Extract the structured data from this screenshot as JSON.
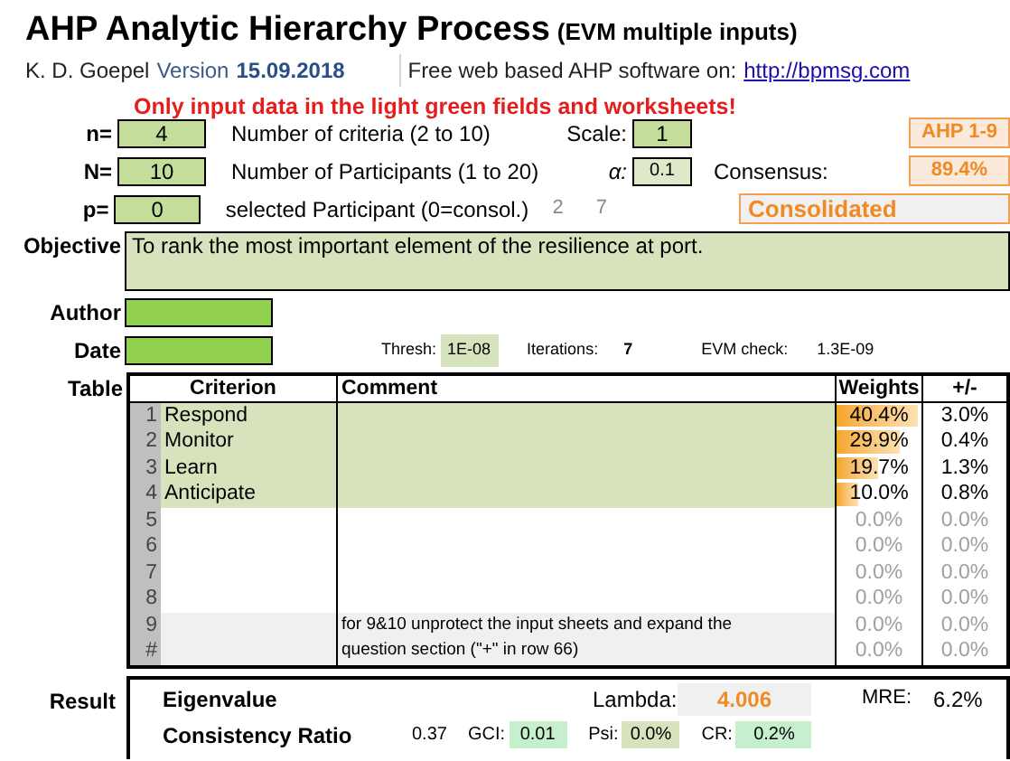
{
  "title": "AHP Analytic Hierarchy Process",
  "title_suffix": "(EVM multiple inputs)",
  "author_line": {
    "author": "K. D. Goepel",
    "version_label": "Version",
    "version": "15.09.2018",
    "promo": "Free web based AHP software on:",
    "link": "http://bpmsg.com"
  },
  "warning": "Only input data in the light green fields and worksheets!",
  "params": [
    {
      "label": "n=",
      "value": "4",
      "description": "Number of criteria (2 to 10)",
      "extra_label": "Scale:",
      "extra_value": "1",
      "note_value": "AHP 1-9"
    },
    {
      "label": "N=",
      "value": "10",
      "description": "Number of Participants (1 to 20)",
      "extra_label": "α:",
      "extra_value": "0.1",
      "note_label": "Consensus:",
      "note_value": "89.4%"
    },
    {
      "label": "p=",
      "value": "0",
      "description": "selected Participant (0=consol.)",
      "extra_label": "2",
      "extra_value": "7",
      "note_value": "Consolidated"
    }
  ],
  "objective": {
    "label": "Objective",
    "value": "To rank the most important element of the resilience at port."
  },
  "author": {
    "label": "Author"
  },
  "date": {
    "label": "Date"
  },
  "stats": {
    "thresh_label": "Thresh:",
    "thresh": "1E-08",
    "iterations_label": "Iterations:",
    "iterations": "7",
    "evm_label": "EVM check:",
    "evm": "1.3E-09"
  },
  "table": {
    "label": "Table",
    "columns": [
      "Criterion",
      "Comment",
      "Weights",
      "+/-"
    ],
    "rows": [
      {
        "number": "1",
        "criterion": "Respond",
        "comment": "",
        "weight": "40.4%",
        "level": 0.95,
        "spread": "3.0%",
        "filled": true,
        "active": true
      },
      {
        "number": "2",
        "criterion": "Monitor",
        "comment": "",
        "weight": "29.9%",
        "level": 0.74,
        "spread": "0.4%",
        "filled": true,
        "active": true
      },
      {
        "number": "3",
        "criterion": "Learn",
        "comment": "",
        "weight": "19.7%",
        "level": 0.49,
        "spread": "1.3%",
        "filled": true,
        "active": true
      },
      {
        "number": "4",
        "criterion": "Anticipate",
        "comment": "",
        "weight": "10.0%",
        "level": 0.25,
        "spread": "0.8%",
        "filled": true,
        "active": true
      },
      {
        "number": "5",
        "criterion": "",
        "comment": "",
        "weight": "0.0%",
        "spread": "0.0%",
        "filled": false,
        "active": false
      },
      {
        "number": "6",
        "criterion": "",
        "comment": "",
        "weight": "0.0%",
        "spread": "0.0%",
        "filled": false,
        "active": false
      },
      {
        "number": "7",
        "criterion": "",
        "comment": "",
        "weight": "0.0%",
        "spread": "0.0%",
        "filled": false,
        "active": false
      },
      {
        "number": "8",
        "criterion": "",
        "comment": "",
        "weight": "0.0%",
        "spread": "0.0%",
        "filled": false,
        "active": false
      },
      {
        "number": "9",
        "criterion": "",
        "comment": "for 9&10 unprotect the input sheets and expand the",
        "weight": "0.0%",
        "spread": "0.0%",
        "filled": false,
        "active": false
      },
      {
        "number": "#",
        "criterion": "",
        "comment": "question section (\"+\" in row 66)",
        "weight": "0.0%",
        "spread": "0.0%",
        "filled": false,
        "active": false
      }
    ]
  },
  "result": {
    "label": "Result",
    "eigenvalue_label": "Eigenvalue",
    "lambda_label": "Lambda:",
    "lambda": "4.006",
    "mre_label": "MRE:",
    "mre": "6.2%",
    "cr_label": "Consistency Ratio",
    "cr_raw": "0.37",
    "gci_label": "GCI:",
    "gci": "0.01",
    "psi_label": "Psi:",
    "psi": "0.0%",
    "cr_short_label": "CR:",
    "cr": "0.2%"
  }
}
